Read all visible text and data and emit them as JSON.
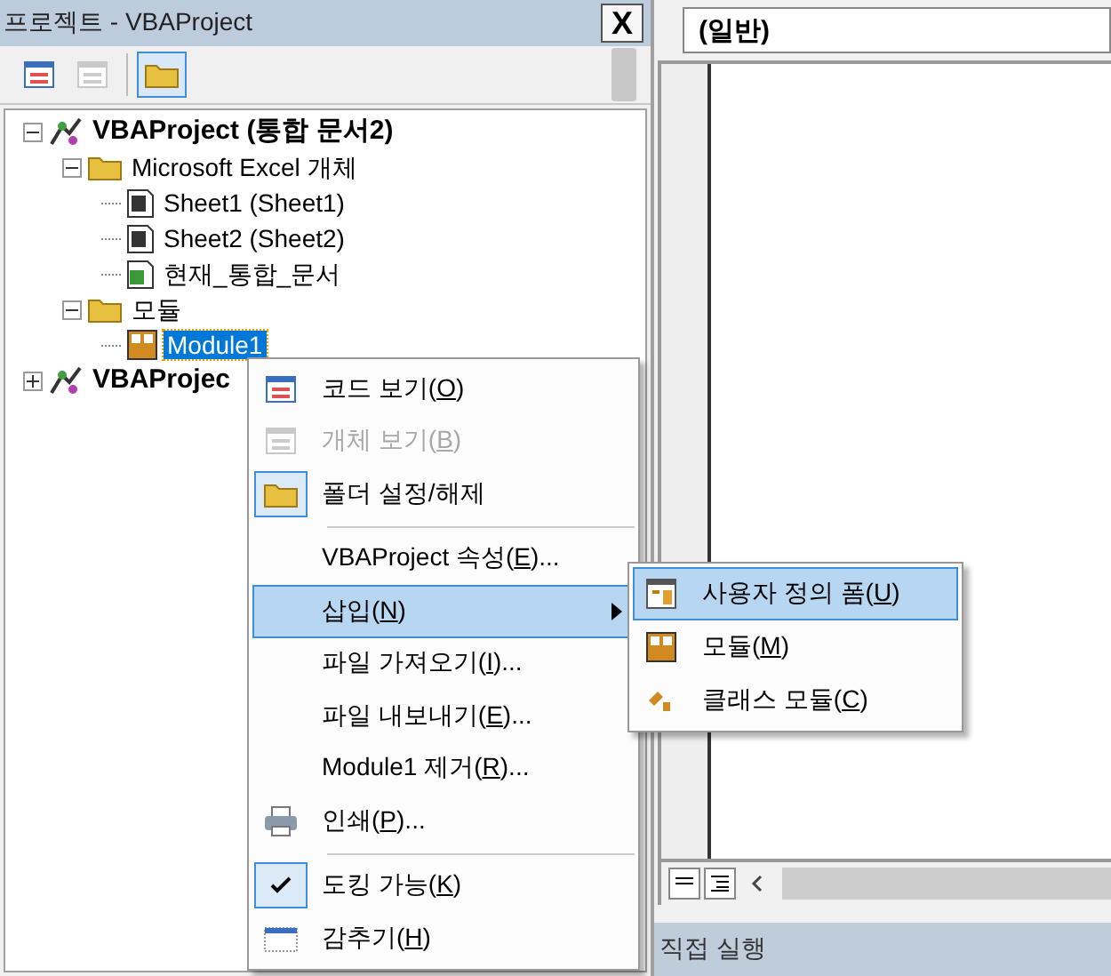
{
  "project_panel": {
    "title": "프로젝트 - VBAProject",
    "close": "X",
    "toolbar": [
      {
        "kind": "code",
        "disabled": false,
        "selected": false
      },
      {
        "kind": "object",
        "disabled": true,
        "selected": false
      },
      {
        "kind": "folder",
        "disabled": false,
        "selected": true
      }
    ],
    "tree": [
      {
        "label": "VBAProject (통합 문서2)",
        "kind": "project",
        "bold": true,
        "expanded": true,
        "selected": false,
        "children": [
          {
            "label": "Microsoft Excel 개체",
            "kind": "folder",
            "bold": false,
            "expanded": true,
            "selected": false,
            "children": [
              {
                "label": "Sheet1 (Sheet1)",
                "kind": "sheet",
                "bold": false,
                "selected": false
              },
              {
                "label": "Sheet2 (Sheet2)",
                "kind": "sheet",
                "bold": false,
                "selected": false
              },
              {
                "label": "현재_통합_문서",
                "kind": "workbook",
                "bold": false,
                "selected": false
              }
            ]
          },
          {
            "label": "모듈",
            "kind": "folder",
            "bold": false,
            "expanded": true,
            "selected": false,
            "children": [
              {
                "label": "Module1",
                "kind": "module",
                "bold": false,
                "selected": true
              }
            ]
          }
        ]
      },
      {
        "label": "VBAProjec",
        "kind": "project",
        "bold": true,
        "expanded": false,
        "selected": false
      }
    ]
  },
  "code_window": {
    "object_box": "(일반)"
  },
  "immediate_window": {
    "title": "직접 실행"
  },
  "context_menu": [
    {
      "kind": "code",
      "before": "코드 보기(",
      "key": "O",
      "after": ")",
      "disabled": false,
      "checked": false,
      "selected": false
    },
    {
      "kind": "object",
      "before": "개체 보기(",
      "key": "B",
      "after": ")",
      "disabled": true,
      "checked": false,
      "selected": false
    },
    {
      "kind": "folder",
      "before": "폴더 설정/해제",
      "disabled": false,
      "checked": true,
      "selected": false
    },
    {
      "kind": "separator"
    },
    {
      "kind": "plain",
      "before": "VBAProject 속성(",
      "key": "E",
      "after": ")...",
      "disabled": false,
      "checked": false,
      "selected": false
    },
    {
      "kind": "plain",
      "before": "삽입(",
      "key": "N",
      "after": ")",
      "disabled": false,
      "checked": false,
      "selected": true,
      "submenu": true
    },
    {
      "kind": "plain",
      "before": "파일 가져오기(",
      "key": "I",
      "after": ")...",
      "disabled": false,
      "checked": false,
      "selected": false
    },
    {
      "kind": "plain",
      "before": "파일 내보내기(",
      "key": "E",
      "after": ")...",
      "disabled": false,
      "checked": false,
      "selected": false
    },
    {
      "kind": "plain",
      "before": "Module1 제거(",
      "key": "R",
      "after": ")...",
      "disabled": false,
      "checked": false,
      "selected": false
    },
    {
      "kind": "print",
      "before": "인쇄(",
      "key": "P",
      "after": ")...",
      "disabled": false,
      "checked": false,
      "selected": false
    },
    {
      "kind": "separator"
    },
    {
      "kind": "check",
      "before": "도킹 가능(",
      "key": "K",
      "after": ")",
      "disabled": false,
      "checked": true,
      "selected": false
    },
    {
      "kind": "hide",
      "before": "감추기(",
      "key": "H",
      "after": ")",
      "disabled": false,
      "checked": false,
      "selected": false
    }
  ],
  "submenu": [
    {
      "kind": "form",
      "before": "사용자 정의 폼(",
      "key": "U",
      "after": ")",
      "disabled": false,
      "checked": false,
      "selected": true
    },
    {
      "kind": "module",
      "before": "모듈(",
      "key": "M",
      "after": ")",
      "disabled": false,
      "checked": false,
      "selected": false
    },
    {
      "kind": "class",
      "before": "클래스 모듈(",
      "key": "C",
      "after": ")",
      "disabled": false,
      "checked": false,
      "selected": false
    }
  ]
}
